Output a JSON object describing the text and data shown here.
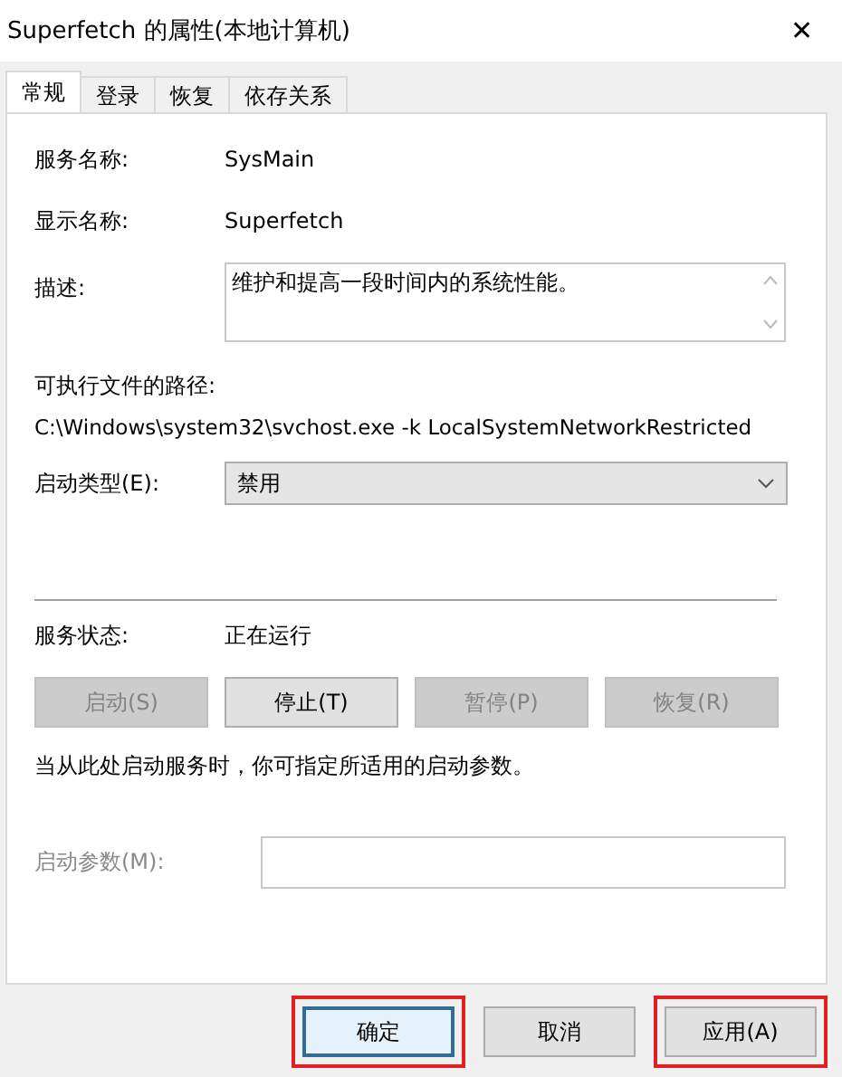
{
  "window": {
    "title": "Superfetch 的属性(本地计算机)",
    "close": "✕"
  },
  "tabs": [
    {
      "label": "常规",
      "selected": true
    },
    {
      "label": "登录",
      "selected": false
    },
    {
      "label": "恢复",
      "selected": false
    },
    {
      "label": "依存关系",
      "selected": false
    }
  ],
  "fields": [
    {
      "label": "服务名称:",
      "value": "SysMain"
    },
    {
      "label": "显示名称:",
      "value": "Superfetch"
    }
  ],
  "description": {
    "label": "描述:",
    "value": "维护和提高一段时间内的系统性能。"
  },
  "path": {
    "label": "可执行文件的路径:",
    "value": "C:\\Windows\\system32\\svchost.exe -k LocalSystemNetworkRestricted"
  },
  "startup_type": {
    "label": "启动类型(E):",
    "value": "禁用"
  },
  "status": {
    "label": "服务状态:",
    "value": "正在运行"
  },
  "service_buttons": [
    {
      "label": "启动(S)",
      "disabled": true
    },
    {
      "label": "停止(T)",
      "disabled": false
    },
    {
      "label": "暂停(P)",
      "disabled": true
    },
    {
      "label": "恢复(R)",
      "disabled": true
    }
  ],
  "hint": "当从此处启动服务时，你可指定所适用的启动参数。",
  "start_params": {
    "label": "启动参数(M):",
    "disabled": true
  },
  "dialog_buttons": [
    {
      "label": "确定",
      "default": true,
      "highlighted": true
    },
    {
      "label": "取消",
      "default": false,
      "highlighted": false
    },
    {
      "label": "应用(A)",
      "default": false,
      "highlighted": true
    }
  ]
}
